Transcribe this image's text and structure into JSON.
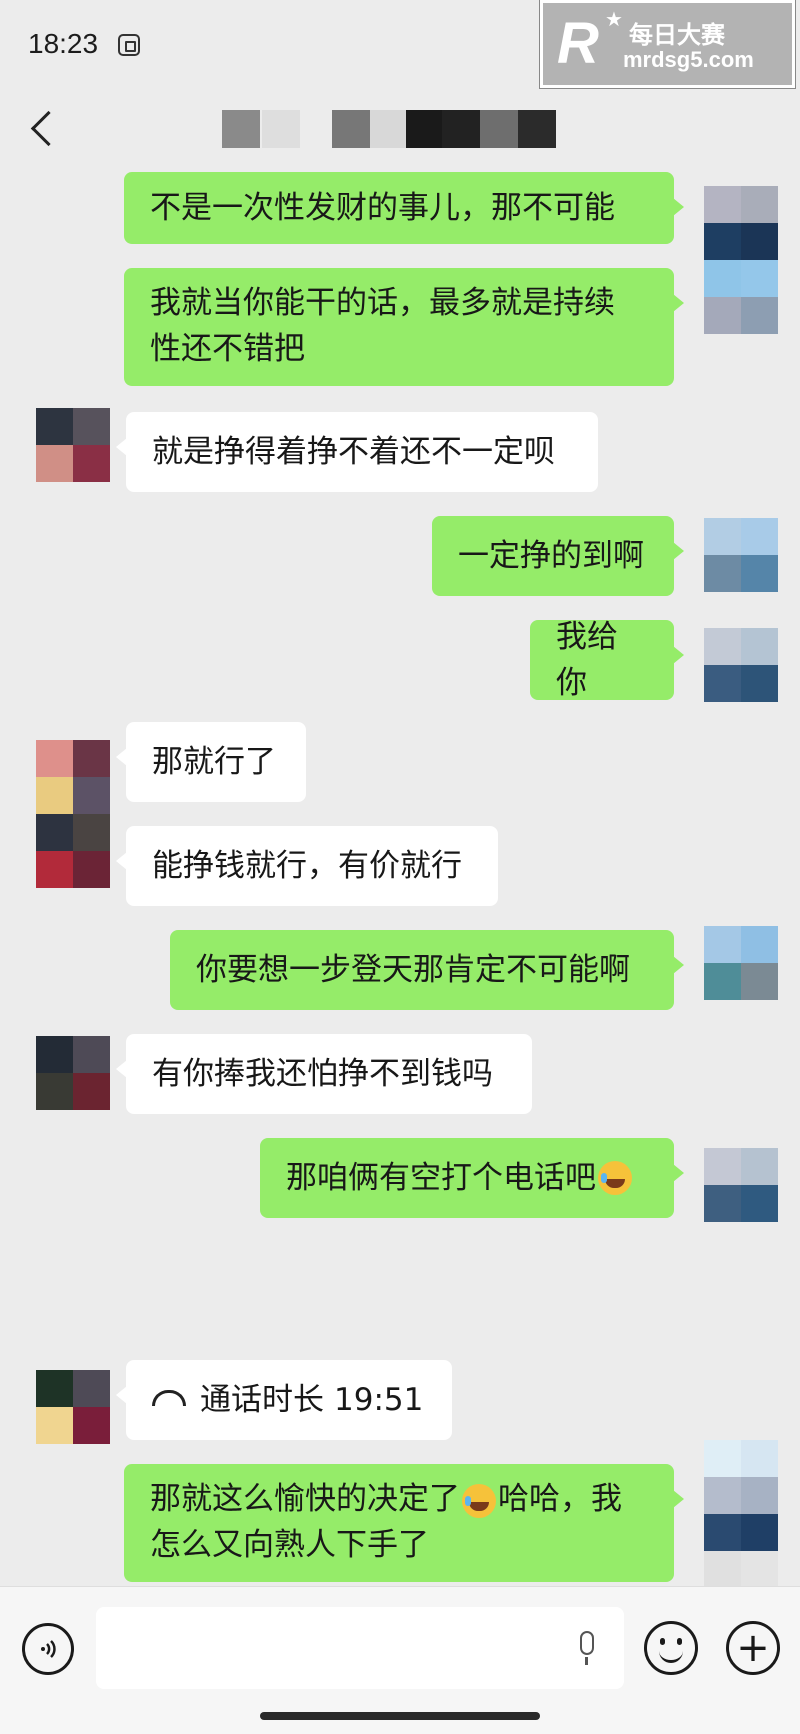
{
  "status_bar": {
    "time": "18:23"
  },
  "watermark": {
    "logo": "R",
    "name": "每日大赛",
    "url": "mrdsg5.com"
  },
  "header": {
    "back_icon": "chevron-left-icon"
  },
  "messages": [
    {
      "side": "right",
      "text": "不是一次性发财的事儿，那不可能"
    },
    {
      "side": "right",
      "line1": "我就当你能干的话，最多就是持续",
      "line2": "性还不错把"
    },
    {
      "side": "left",
      "text": "就是挣得着挣不着还不一定呗"
    },
    {
      "side": "right",
      "text": "一定挣的到啊"
    },
    {
      "side": "right",
      "text": "我给你"
    },
    {
      "side": "left",
      "text": "那就行了"
    },
    {
      "side": "left",
      "text": "能挣钱就行，有价就行"
    },
    {
      "side": "right",
      "text": "你要想一步登天那肯定不可能啊"
    },
    {
      "side": "left",
      "text": "有你捧我还怕挣不到钱吗"
    },
    {
      "side": "right",
      "text": "那咱俩有空打个电话吧",
      "emoji": "laughing-tears-emoji"
    },
    {
      "side": "left",
      "type": "call",
      "label": "通话时长",
      "duration": "19:51",
      "icon": "phone-hangup-icon"
    },
    {
      "side": "right",
      "line1a": "那就这么愉快的决定了",
      "emoji": "laughing-tears-emoji",
      "line1b": "哈哈，我",
      "line2": "怎么又向熟人下手了"
    }
  ],
  "input_bar": {
    "voice_icon": "voice-icon",
    "mic_icon": "microphone-icon",
    "emoji_icon": "smiley-icon",
    "plus_icon": "plus-icon",
    "plus_glyph": "+"
  },
  "colors": {
    "sent_bubble": "#95ec69",
    "received_bubble": "#ffffff",
    "background": "#ececec"
  }
}
